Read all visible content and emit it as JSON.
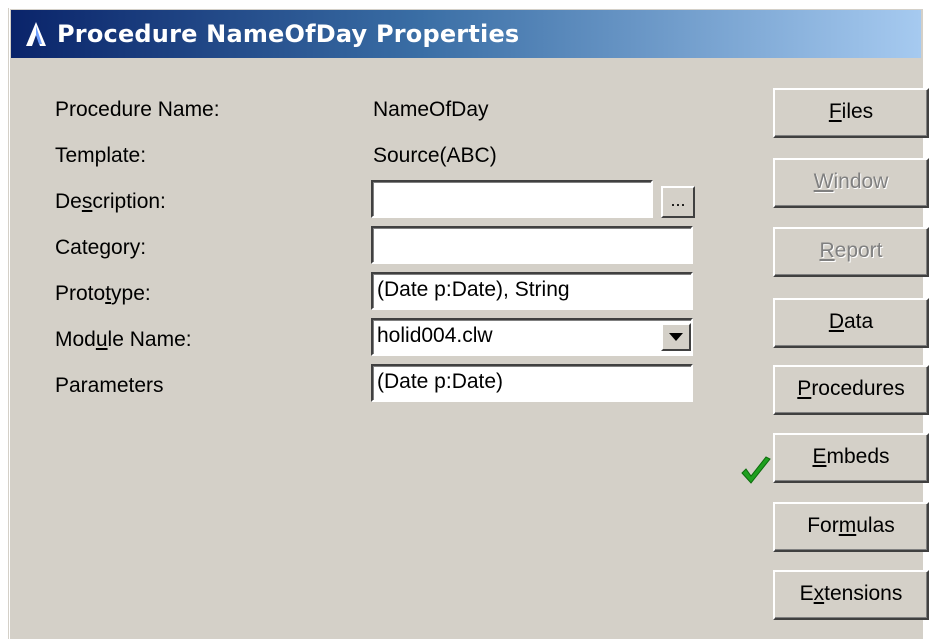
{
  "window": {
    "title": "Procedure NameOfDay Properties"
  },
  "form": {
    "procedure_name_label": "Procedure Name:",
    "procedure_name_value": "NameOfDay",
    "template_label": "Template:",
    "template_value": "Source(ABC)",
    "description_label_pre": "De",
    "description_label_ul": "s",
    "description_label_post": "cription:",
    "description_value": "",
    "description_button": "...",
    "category_label": "Category:",
    "category_value": "",
    "prototype_label_pre": "Proto",
    "prototype_label_ul": "t",
    "prototype_label_post": "ype:",
    "prototype_value": "(Date p:Date), String",
    "module_label_pre": "Mod",
    "module_label_ul": "u",
    "module_label_post": "le Name:",
    "module_value": "holid004.clw",
    "parameters_label": "Parameters",
    "parameters_value": "(Date p:Date)"
  },
  "buttons": {
    "files": {
      "ul": "F",
      "rest": "iles",
      "enabled": true
    },
    "window": {
      "ul": "W",
      "rest": "indow",
      "enabled": false
    },
    "report": {
      "ul": "R",
      "rest": "eport",
      "enabled": false
    },
    "data": {
      "ul": "D",
      "rest": "ata",
      "enabled": true
    },
    "procedures": {
      "ul": "P",
      "rest": "rocedures",
      "enabled": true
    },
    "embeds": {
      "ul": "E",
      "rest": "mbeds",
      "enabled": true,
      "checked": true
    },
    "formulas": {
      "pre": "For",
      "ul": "m",
      "rest": "ulas",
      "enabled": true
    },
    "extensions": {
      "pre": "E",
      "ul": "x",
      "rest": "tensions",
      "enabled": true
    }
  },
  "colors": {
    "titlebar_start": "#0a246a",
    "titlebar_end": "#a6caf0",
    "dialog_bg": "#d4d0c8",
    "check_green": "#1fa01f"
  },
  "icons": {
    "title": "app-icon",
    "embeds_status": "checkmark-icon"
  }
}
